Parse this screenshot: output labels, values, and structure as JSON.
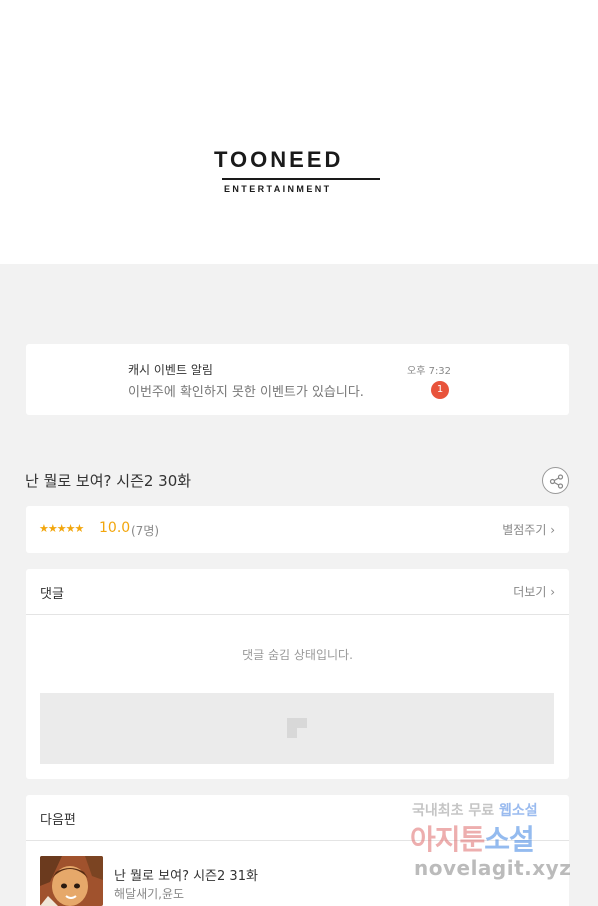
{
  "banner": {
    "logo": {
      "main": "TOONEED",
      "sub": "ENTERTAINMENT"
    }
  },
  "notice": {
    "title": "캐시 이벤트 알림",
    "text": "이번주에 확인하지 못한 이벤트가 있습니다.",
    "time": "오후 7:32",
    "badge_count": "1"
  },
  "episode": {
    "title": "난 뭘로 보여? 시즌2 30화"
  },
  "rating": {
    "stars": "★★★★★",
    "score": "10.0",
    "count": "(7명)",
    "rate_label": "별점주기 ›"
  },
  "comments": {
    "title": "댓글",
    "more_label": "더보기 ›",
    "hidden_text": "댓글 숨김 상태입니다."
  },
  "next_episode": {
    "section_title": "다음편",
    "title": "난 뭘로 보여? 시즌2 31화",
    "author": "해달새기,윤도"
  },
  "watermark": {
    "line1_a": "국내최초 무료 ",
    "line1_b": "웹소설",
    "line2_a": "아지툰",
    "line2_b": "소설",
    "line3": "novelagit.xyz"
  },
  "colors": {
    "accent": "#f2a60d",
    "badge": "#e8533b",
    "background": "#f2f2f2"
  },
  "icons": [
    "share-icon",
    "ad-placeholder-icon"
  ]
}
